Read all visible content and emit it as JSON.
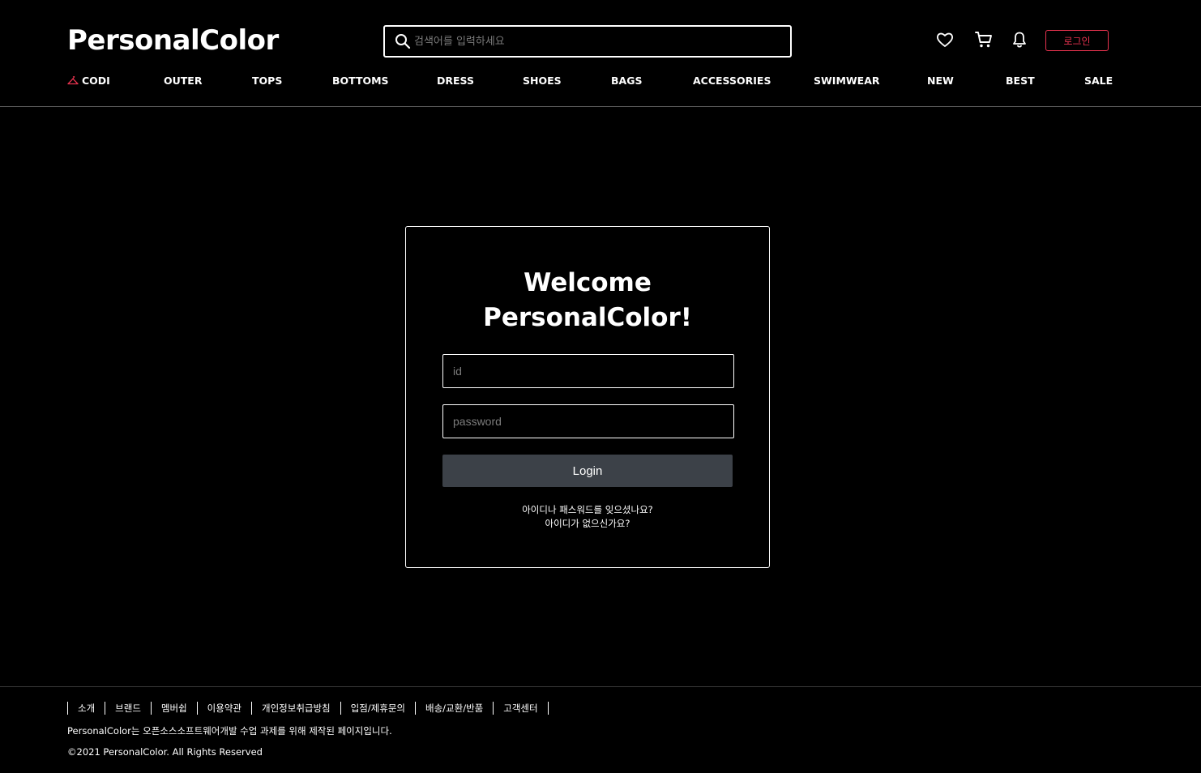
{
  "header": {
    "logo": "PersonalColor",
    "search": {
      "placeholder": "검색어를 입력하세요",
      "value": ""
    },
    "icons": [
      "heart-icon",
      "cart-icon",
      "bell-icon"
    ],
    "login_label": "로그인",
    "accent_color": "#e8334f"
  },
  "nav": {
    "items": [
      "CODI",
      "OUTER",
      "TOPS",
      "BOTTOMS",
      "DRESS",
      "SHOES",
      "BAGS",
      "ACCESSORIES",
      "SWIMWEAR",
      "NEW",
      "BEST",
      "SALE"
    ]
  },
  "login_card": {
    "title_line1": "Welcome",
    "title_line2": "PersonalColor!",
    "id_placeholder": "id",
    "password_placeholder": "password",
    "submit_label": "Login",
    "forgot_link": "아이디나 패스워드를 잊으셨나요?",
    "signup_link": "아이디가 없으신가요?",
    "button_color": "#3c4148"
  },
  "footer": {
    "links": [
      "소개",
      "브랜드",
      "멤버쉽",
      "이용약관",
      "개인정보취급방침",
      "입점/제휴문의",
      "배송/교환/반품",
      "고객센터"
    ],
    "description": "PersonalColor는 오픈소스소프트웨어개발 수업 과제를 위해 제작된 페이지입니다.",
    "copyright": "©2021 PersonalColor. All Rights Reserved"
  }
}
